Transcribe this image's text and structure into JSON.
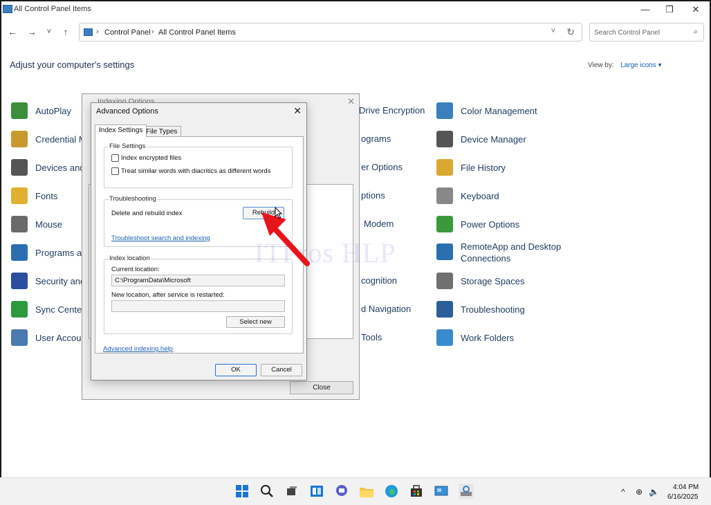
{
  "window": {
    "title": "All Control Panel Items"
  },
  "window_controls": {
    "minimize": "—",
    "restore": "❐",
    "close": "✕"
  },
  "nav": {
    "back": "←",
    "forward": "→",
    "recent": "˅",
    "up": "↑"
  },
  "address": {
    "separator": "›",
    "crumbs": [
      "Control Panel",
      "All Control Panel Items"
    ],
    "dropdown": "˅",
    "refresh": "↻"
  },
  "search": {
    "placeholder": "Search Control Panel",
    "icon": "⌕"
  },
  "header": {
    "heading": "Adjust your computer's settings",
    "view_by_label": "View by:",
    "view_by_value": "Large icons ▾"
  },
  "left_items": [
    {
      "label": "AutoPlay",
      "color": "#3a8f3a"
    },
    {
      "label": "Credential M",
      "color": "#c89a2e"
    },
    {
      "label": "Devices and",
      "color": "#555555"
    },
    {
      "label": "Fonts",
      "color": "#e0b030"
    },
    {
      "label": "Mouse",
      "color": "#6a6a6a"
    },
    {
      "label": "Programs ar",
      "color": "#2a6fb0"
    },
    {
      "label": "Security and",
      "color": "#2a4fa0"
    },
    {
      "label": "Sync Center",
      "color": "#2e9a3e"
    },
    {
      "label": "User Accour",
      "color": "#4a7ab0"
    }
  ],
  "middle_fragments": [
    "Drive Encryption",
    "ograms",
    "er Options",
    "ptions",
    "Modem",
    "cognition",
    "d Navigation",
    "Tools"
  ],
  "right_items": [
    {
      "label": "Color Management",
      "color": "#3a7fc0"
    },
    {
      "label": "Device Manager",
      "color": "#555555"
    },
    {
      "label": "File History",
      "color": "#d9a830"
    },
    {
      "label": "Keyboard",
      "color": "#888888"
    },
    {
      "label": "Power Options",
      "color": "#3a9a3a"
    },
    {
      "label": "RemoteApp and Desktop",
      "label2": "Connections",
      "color": "#2a6fb0"
    },
    {
      "label": "Storage Spaces",
      "color": "#707070"
    },
    {
      "label": "Troubleshooting",
      "color": "#2a5f9a"
    },
    {
      "label": "Work Folders",
      "color": "#3a8ad0"
    }
  ],
  "indexing_dialog": {
    "title": "Indexing Options",
    "close_icon": "✕",
    "close_button": "Close"
  },
  "advanced_dialog": {
    "title": "Advanced Options",
    "close_icon": "✕",
    "tabs": [
      "Index Settings",
      "File Types"
    ],
    "file_settings": {
      "title": "File Settings",
      "options": [
        "Index encrypted files",
        "Treat similar words with diacritics as different words"
      ]
    },
    "troubleshooting": {
      "title": "Troubleshooting",
      "rebuild_label": "Delete and rebuild index",
      "rebuild_button": "Rebuild",
      "link": "Troubleshoot search and indexing"
    },
    "index_location": {
      "title": "Index location",
      "current_label": "Current location:",
      "current_value": "C:\\ProgramData\\Microsoft",
      "new_label": "New location, after service is restarted:",
      "new_value": "",
      "select_button": "Select new"
    },
    "help_link": "Advanced indexing help",
    "ok": "OK",
    "cancel": "Cancel"
  },
  "watermark": "ITPros HLP",
  "taskbar": {
    "tray": {
      "chevron": "^",
      "network": "⊕",
      "volume": "🔈"
    },
    "clock_time": "4:04 PM",
    "clock_date": "6/16/2025"
  }
}
